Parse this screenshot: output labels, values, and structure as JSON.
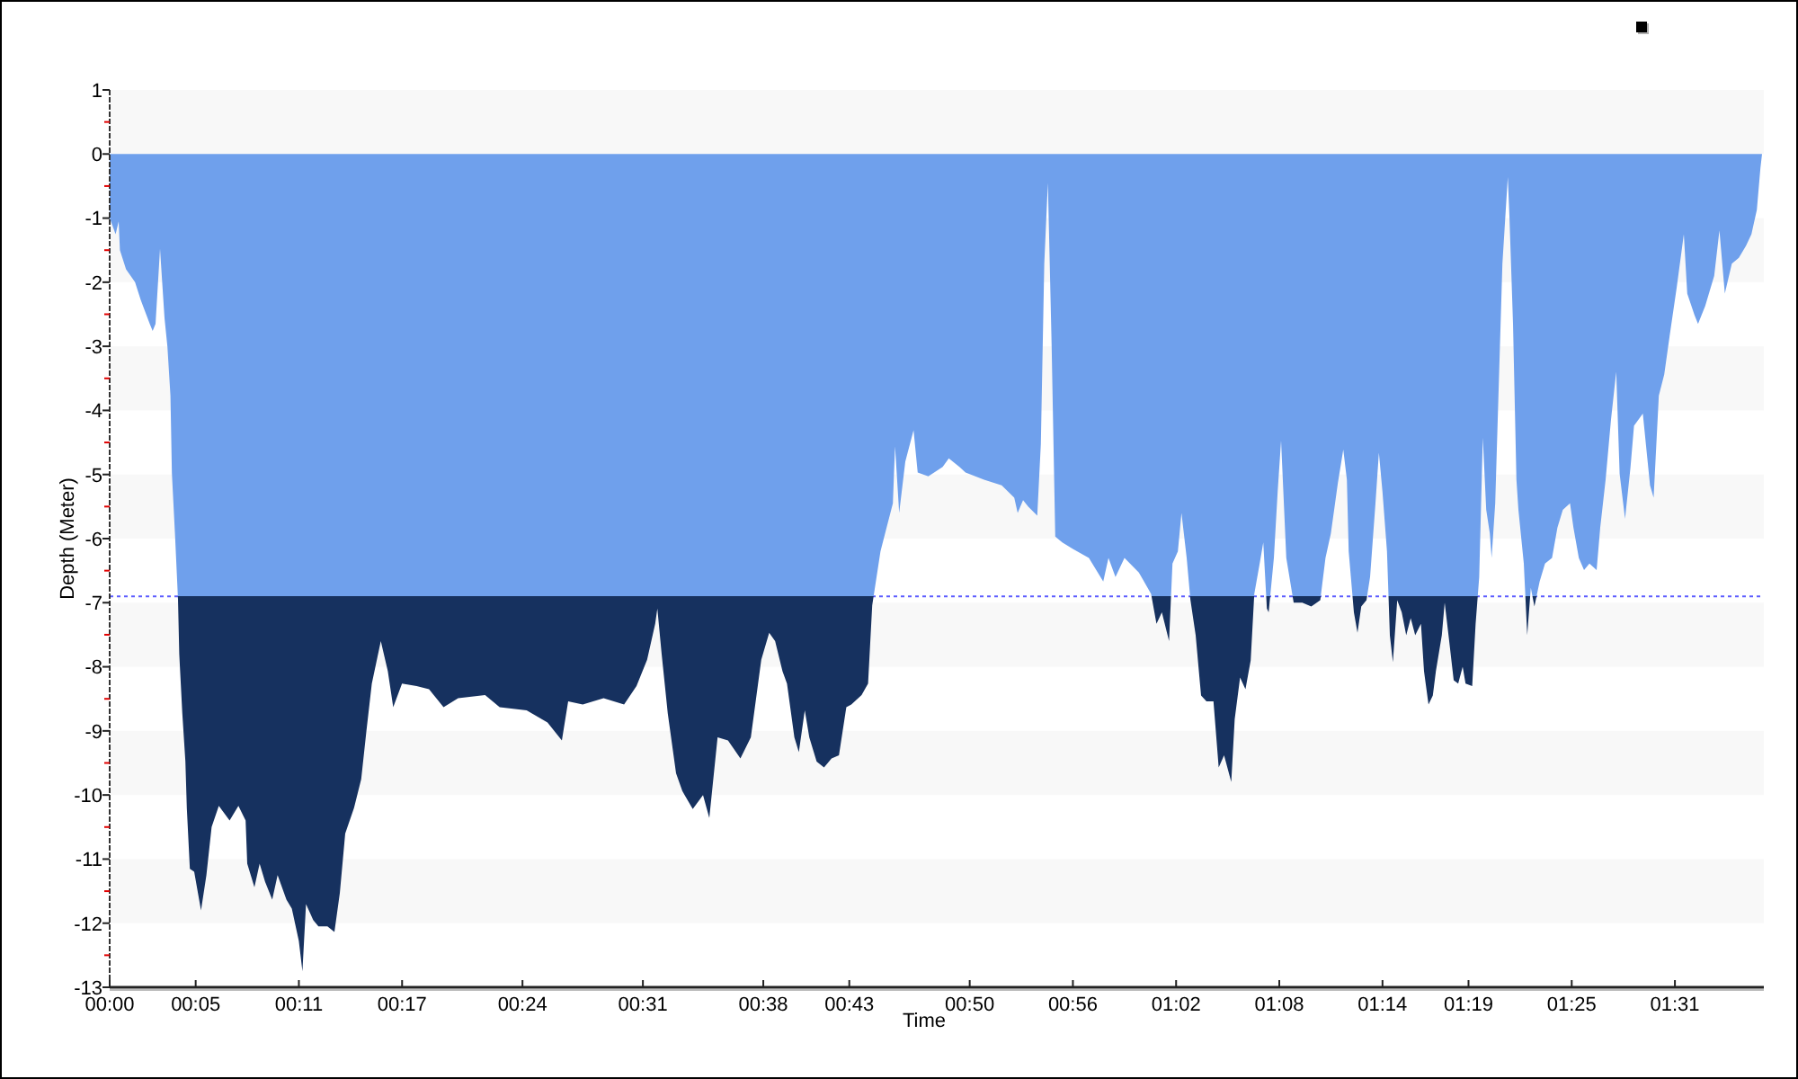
{
  "chart": {
    "chart_data": {
      "type": "area",
      "xlabel": "Time",
      "ylabel": "Depth (Meter)",
      "x": [
        0,
        0.34,
        0.52,
        0.6,
        0.95,
        1.47,
        1.81,
        2.33,
        2.5,
        2.67,
        2.93,
        3.19,
        3.36,
        3.53,
        3.62,
        3.79,
        3.97,
        4.05,
        4.22,
        4.4,
        4.48,
        4.66,
        4.91,
        5.31,
        5.62,
        5.93,
        6.34,
        6.97,
        7.48,
        7.9,
        8.0,
        8.41,
        8.72,
        9.03,
        9.45,
        9.76,
        10.28,
        10.59,
        11,
        11.21,
        11.41,
        11.83,
        12.14,
        12.66,
        13.07,
        13.38,
        13.69,
        14.21,
        14.62,
        14.93,
        15.24,
        15.76,
        16.17,
        16.48,
        17,
        17.84,
        18.57,
        19.41,
        20.26,
        21.83,
        22.67,
        24.24,
        25.45,
        26.29,
        26.66,
        27.5,
        28.71,
        29.91,
        30.63,
        31.24,
        31.72,
        31.84,
        32.09,
        32.45,
        32.93,
        33.29,
        33.9,
        34.5,
        34.86,
        35.34,
        35.95,
        36.67,
        37.28,
        37.88,
        38.34,
        38.69,
        39.12,
        39.38,
        39.81,
        40.07,
        40.41,
        40.67,
        41.1,
        41.53,
        41.97,
        42.4,
        42.83,
        43.12,
        43.72,
        44.09,
        44.33,
        44.81,
        45.17,
        45.53,
        45.66,
        45.9,
        46.26,
        46.74,
        46.98,
        47.59,
        48.43,
        48.79,
        49.4,
        49.76,
        50.83,
        51.86,
        52.59,
        52.79,
        53.1,
        53.41,
        53.93,
        54.14,
        54.34,
        54.55,
        54.76,
        54.97,
        55.38,
        56,
        56.93,
        57.76,
        58.07,
        58.48,
        59.0,
        59.83,
        60.55,
        60.86,
        61.17,
        61.59,
        61.79,
        62.1,
        62.31,
        62.62,
        62.83,
        63.14,
        63.45,
        63.76,
        64.17,
        64.48,
        64.79,
        65.21,
        65.41,
        65.72,
        66.03,
        66.34,
        66.55,
        66.86,
        67.07,
        67.28,
        67.38,
        67.69,
        67.9,
        68.1,
        68.41,
        68.83,
        69.34,
        69.86,
        70.38,
        70.69,
        71.0,
        71.41,
        71.72,
        71.93,
        72.03,
        72.34,
        72.55,
        72.76,
        73.07,
        73.28,
        73.59,
        73.79,
        74,
        74.26,
        74.43,
        74.6,
        74.86,
        75.12,
        75.38,
        75.64,
        75.9,
        76.24,
        76.41,
        76.67,
        76.93,
        77.1,
        77.45,
        77.62,
        77.88,
        78.14,
        78.4,
        78.66,
        78.83,
        79.21,
        79.41,
        79.62,
        79.83,
        80.03,
        80.24,
        80.34,
        80.55,
        80.76,
        80.97,
        81.28,
        81.38,
        81.59,
        81.79,
        81.9,
        82.21,
        82.41,
        82.62,
        82.83,
        83.14,
        83.45,
        83.86,
        84.17,
        84.48,
        84.9,
        85.1,
        85.41,
        85.72,
        86.03,
        86.45,
        86.66,
        86.97,
        87.28,
        87.59,
        87.79,
        88.1,
        88.41,
        88.62,
        89.14,
        89.55,
        89.76,
        90.07,
        90.38,
        90.69,
        91.1,
        91.52,
        91.72,
        92.14,
        92.34,
        92.76,
        93.28,
        93.59,
        93.9,
        94.31,
        94.72,
        95.14,
        95.45,
        95.76,
        95.97,
        96.07
      ],
      "series": [
        {
          "color": "#6fa0ec",
          "values": [
            -1.0,
            -1.25,
            -1.05,
            -1.5,
            -1.8,
            -2.0,
            -2.28,
            -2.65,
            -2.76,
            -2.65,
            -1.48,
            -2.56,
            -3.0,
            -3.77,
            -4.98,
            -5.92,
            -6.95,
            -7.8,
            -8.73,
            -9.47,
            -10.2,
            -11.15,
            -11.2,
            -11.8,
            -11.25,
            -10.5,
            -10.17,
            -10.4,
            -10.17,
            -10.4,
            -11.07,
            -11.44,
            -11.07,
            -11.35,
            -11.63,
            -11.25,
            -11.63,
            -11.77,
            -12.28,
            -12.75,
            -11.7,
            -11.95,
            -12.05,
            -12.05,
            -12.14,
            -11.53,
            -10.6,
            -10.2,
            -9.75,
            -9.0,
            -8.26,
            -7.6,
            -8.07,
            -8.63,
            -8.26,
            -8.3,
            -8.35,
            -8.63,
            -8.49,
            -8.44,
            -8.63,
            -8.68,
            -8.87,
            -9.15,
            -8.54,
            -8.59,
            -8.49,
            -8.59,
            -8.3,
            -7.89,
            -7.33,
            -7.09,
            -7.8,
            -8.73,
            -9.66,
            -9.94,
            -10.22,
            -10.0,
            -10.36,
            -9.1,
            -9.15,
            -9.43,
            -9.1,
            -7.89,
            -7.47,
            -7.6,
            -8.07,
            -8.26,
            -9.1,
            -9.33,
            -8.68,
            -9.1,
            -9.48,
            -9.57,
            -9.43,
            -9.38,
            -8.63,
            -8.59,
            -8.44,
            -8.26,
            -7.04,
            -6.2,
            -5.83,
            -5.45,
            -4.56,
            -5.6,
            -4.8,
            -4.31,
            -4.97,
            -5.03,
            -4.88,
            -4.75,
            -4.88,
            -4.97,
            -5.08,
            -5.17,
            -5.36,
            -5.6,
            -5.4,
            -5.5,
            -5.64,
            -4.52,
            -1.71,
            -0.45,
            -3.0,
            -5.97,
            -6.06,
            -6.16,
            -6.3,
            -6.67,
            -6.3,
            -6.6,
            -6.3,
            -6.53,
            -6.86,
            -7.33,
            -7.15,
            -7.6,
            -6.39,
            -6.2,
            -5.6,
            -6.3,
            -6.96,
            -7.51,
            -8.45,
            -8.54,
            -8.54,
            -9.57,
            -9.38,
            -9.8,
            -8.82,
            -8.17,
            -8.35,
            -7.9,
            -6.86,
            -6.39,
            -6.06,
            -7.09,
            -7.15,
            -6.3,
            -5.27,
            -4.47,
            -6.3,
            -7.0,
            -7.0,
            -7.06,
            -6.96,
            -6.3,
            -5.92,
            -5.13,
            -4.61,
            -5.08,
            -6.2,
            -7.15,
            -7.47,
            -7.06,
            -6.96,
            -6.6,
            -5.45,
            -4.66,
            -5.27,
            -6.2,
            -7.51,
            -7.93,
            -6.96,
            -7.15,
            -7.51,
            -7.24,
            -7.51,
            -7.33,
            -8.07,
            -8.59,
            -8.45,
            -8.07,
            -7.51,
            -7.0,
            -7.6,
            -8.21,
            -8.26,
            -8.0,
            -8.26,
            -8.3,
            -7.33,
            -6.6,
            -4.43,
            -5.55,
            -5.92,
            -6.3,
            -5.45,
            -3.58,
            -1.71,
            -0.36,
            -0.97,
            -2.65,
            -5.08,
            -5.55,
            -6.39,
            -7.51,
            -6.77,
            -7.06,
            -6.67,
            -6.39,
            -6.3,
            -5.83,
            -5.55,
            -5.45,
            -5.83,
            -6.3,
            -6.49,
            -6.39,
            -6.49,
            -5.83,
            -5.08,
            -4.14,
            -3.4,
            -4.99,
            -5.69,
            -4.9,
            -4.24,
            -4.05,
            -5.17,
            -5.36,
            -3.77,
            -3.44,
            -2.84,
            -2.09,
            -1.25,
            -2.18,
            -2.51,
            -2.65,
            -2.37,
            -1.9,
            -1.19,
            -2.18,
            -1.71,
            -1.62,
            -1.43,
            -1.25,
            -0.87,
            -0.22,
            0
          ]
        }
      ],
      "xlim": [
        0,
        96.17
      ],
      "ylim": [
        -13,
        1
      ],
      "xticks": [
        {
          "value": 0,
          "label": "00:00"
        },
        {
          "value": 5,
          "label": "00:05"
        },
        {
          "value": 11,
          "label": "00:11"
        },
        {
          "value": 17,
          "label": "00:17"
        },
        {
          "value": 24,
          "label": "00:24"
        },
        {
          "value": 31,
          "label": "00:31"
        },
        {
          "value": 38,
          "label": "00:38"
        },
        {
          "value": 43,
          "label": "00:43"
        },
        {
          "value": 50,
          "label": "00:50"
        },
        {
          "value": 56,
          "label": "00:56"
        },
        {
          "value": 62,
          "label": "01:02"
        },
        {
          "value": 68,
          "label": "01:08"
        },
        {
          "value": 74,
          "label": "01:14"
        },
        {
          "value": 79,
          "label": "01:19"
        },
        {
          "value": 85,
          "label": "01:25"
        },
        {
          "value": 91,
          "label": "01:31"
        }
      ],
      "yticks": [
        1,
        0,
        -1,
        -2,
        -3,
        -4,
        -5,
        -6,
        -7,
        -8,
        -9,
        -10,
        -11,
        -12,
        -13
      ],
      "ref_lines": [
        {
          "axis": "y",
          "value": -6.9,
          "color": "#5c5cff"
        }
      ]
    }
  }
}
